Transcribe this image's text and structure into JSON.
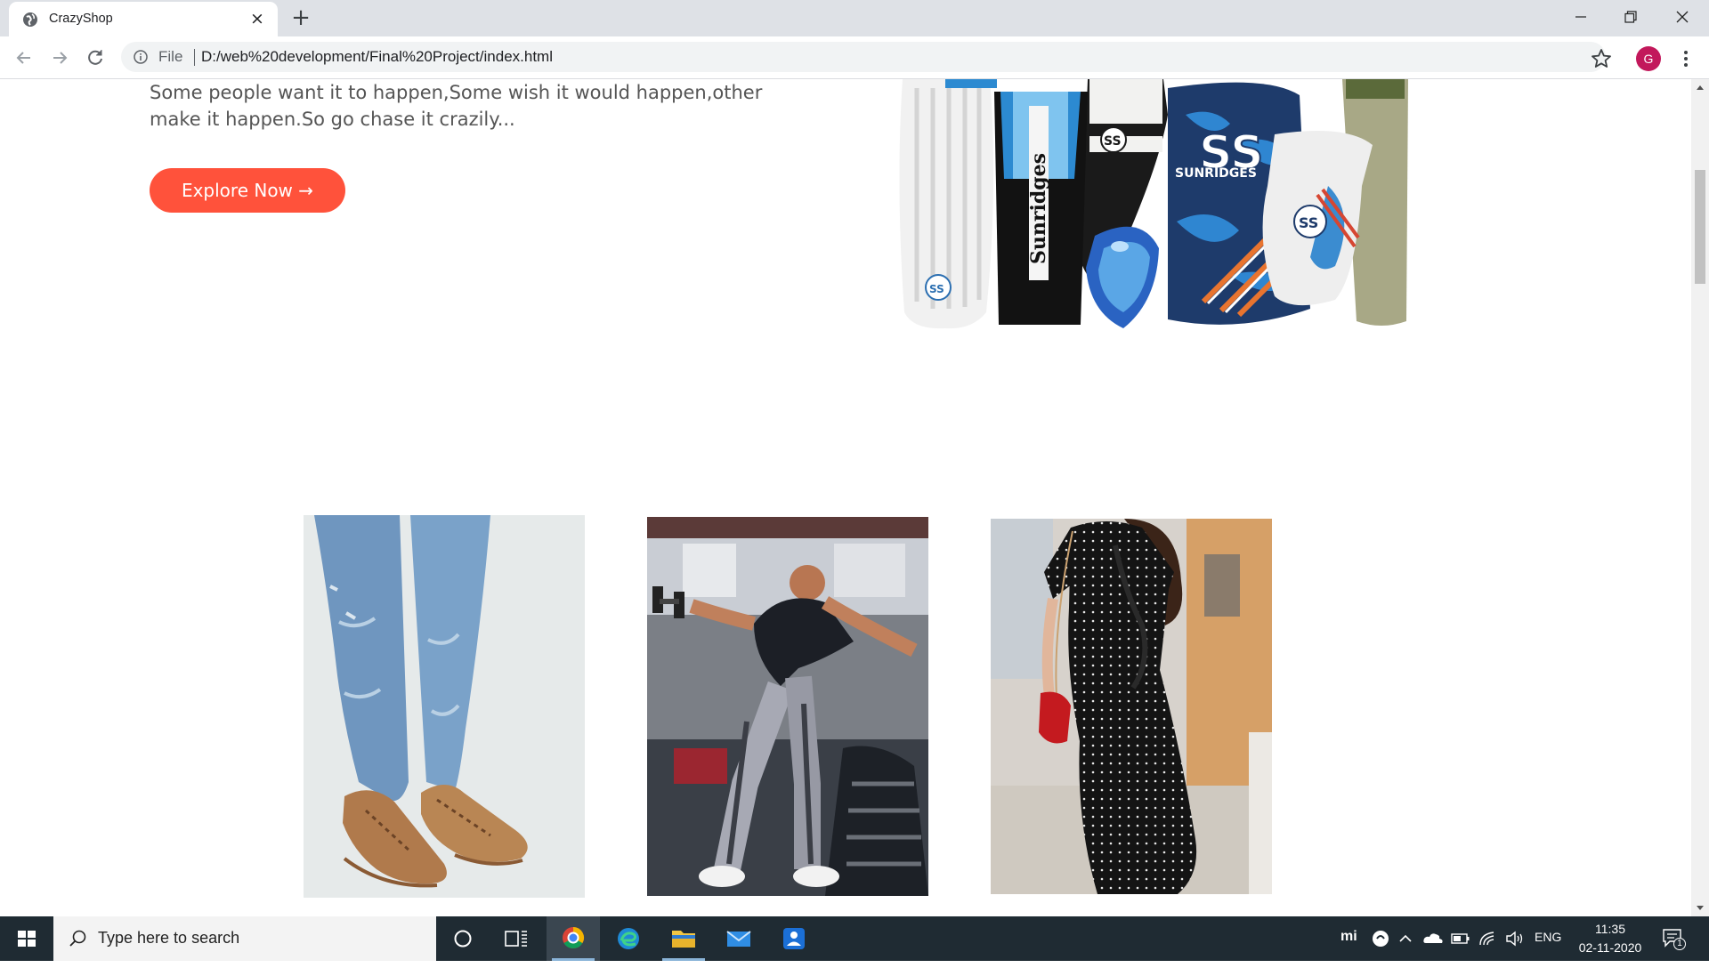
{
  "browser": {
    "tab_title": "CrazyShop",
    "tab_close": "×",
    "new_tab": "+",
    "address_scheme": "File",
    "address_url": "D:/web%20development/Final%20Project/index.html",
    "profile_initial": "G",
    "profile_color": "#c2185b"
  },
  "page": {
    "hero_text": "Some people want it to happen,Some wish it would happen,other make it happen.So go chase it crazily...",
    "explore_button": "Explore Now →",
    "accent_color": "#ff523b",
    "hero_image": "cricket-gear-image",
    "categories": [
      {
        "image": "shoes-jeans-image"
      },
      {
        "image": "gym-workout-image"
      },
      {
        "image": "polka-dress-image"
      }
    ]
  },
  "taskbar": {
    "search_placeholder": "Type here to search",
    "language": "ENG",
    "time": "11:35",
    "date": "02-11-2020",
    "notifications": "1",
    "tray_mi": "mi"
  }
}
